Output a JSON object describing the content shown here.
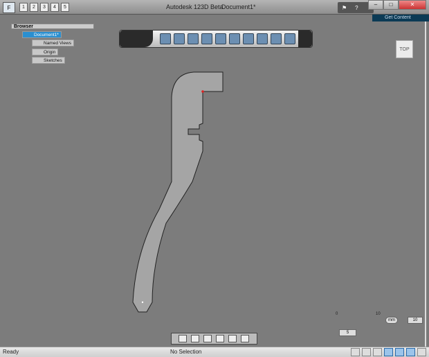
{
  "window": {
    "app_title": "Autodesk 123D Beta",
    "document_title": "Document1*",
    "get_content": "Get Content",
    "app_button": "F"
  },
  "quick_access": [
    "1",
    "2",
    "3",
    "4",
    "5"
  ],
  "browser": {
    "title": "Browser",
    "root": "Document1*",
    "items": [
      "Named Views",
      "Origin",
      "Sketches"
    ]
  },
  "viewcube": {
    "face": "TOP"
  },
  "grid": {
    "min_label": "0",
    "max_label": "10",
    "unit": "mm",
    "spacing": "5",
    "value": "10"
  },
  "status": {
    "left": "Ready",
    "center": "No Selection"
  },
  "accent": "#2a8fd0"
}
